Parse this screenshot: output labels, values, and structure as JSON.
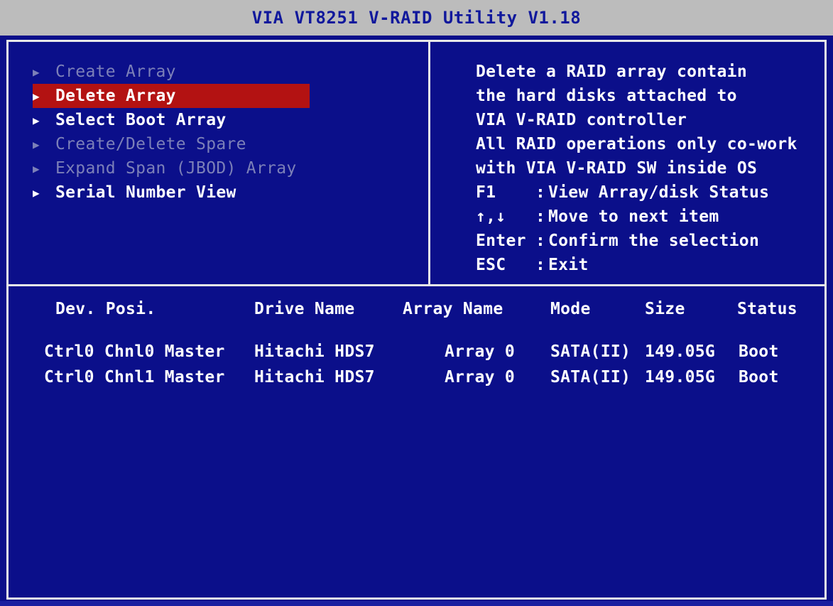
{
  "title": "VIA VT8251 V-RAID Utility V1.18",
  "colors": {
    "background": "#0b0f8a",
    "titlebar": "#bcbcbc",
    "title_text": "#10189c",
    "selected_bg": "#b31212",
    "disabled_text": "#7c80b8",
    "text": "#ffffff"
  },
  "menu": {
    "items": [
      {
        "label": "Create Array",
        "state": "disabled"
      },
      {
        "label": "Delete Array",
        "state": "selected"
      },
      {
        "label": "Select Boot Array",
        "state": "enabled"
      },
      {
        "label": "Create/Delete Spare",
        "state": "disabled"
      },
      {
        "label": "Expand Span (JBOD) Array",
        "state": "disabled"
      },
      {
        "label": "Serial Number View",
        "state": "enabled"
      }
    ],
    "arrow_icon": "▶"
  },
  "help": {
    "description": [
      "Delete a RAID array contain",
      "the hard disks attached to",
      "VIA V-RAID controller",
      "All RAID operations only co-work",
      "with VIA V-RAID SW inside OS"
    ],
    "keys": [
      {
        "key": "F1",
        "sep": ":",
        "desc": "View Array/disk Status"
      },
      {
        "key": "↑,↓",
        "sep": ":",
        "desc": "Move to next item"
      },
      {
        "key": "Enter",
        "sep": ":",
        "desc": "Confirm the selection"
      },
      {
        "key": "ESC",
        "sep": ":",
        "desc": "Exit"
      }
    ]
  },
  "table": {
    "headers": {
      "dev": "Dev. Posi.",
      "drive": "Drive Name",
      "array": "Array Name",
      "mode": "Mode",
      "size": "Size",
      "status": "Status"
    },
    "rows": [
      {
        "dev": "Ctrl0 Chnl0 Master",
        "drive": "Hitachi HDS7",
        "array": "Array 0",
        "mode": "SATA(II)",
        "size": "149.05G",
        "status": "Boot"
      },
      {
        "dev": "Ctrl0 Chnl1 Master",
        "drive": "Hitachi HDS7",
        "array": "Array 0",
        "mode": "SATA(II)",
        "size": "149.05G",
        "status": "Boot"
      }
    ]
  }
}
